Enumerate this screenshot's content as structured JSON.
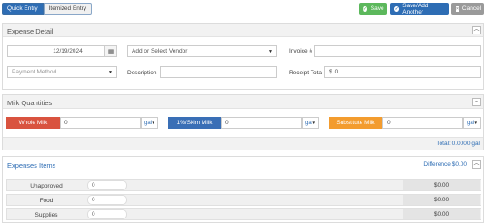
{
  "modes": {
    "quick": "Quick Entry",
    "itemized": "Itemized Entry"
  },
  "actions": {
    "save": "Save",
    "save_add": "Save/Add Another",
    "cancel": "Cancel"
  },
  "expense_detail": {
    "title": "Expense Detail",
    "date": "12/19/2024",
    "vendor_placeholder": "Add or Select Vendor",
    "invoice_label": "Invoice #",
    "invoice_value": "",
    "payment_placeholder": "Payment Method",
    "description_label": "Description",
    "description_value": "",
    "receipt_label": "Receipt Total",
    "receipt_currency": "$",
    "receipt_value": "0"
  },
  "milk": {
    "title": "Milk Quantities",
    "items": [
      {
        "label": "Whole Milk",
        "value": "0",
        "unit": "gal",
        "color": "#d9533f"
      },
      {
        "label": "1%/Skim Milk",
        "value": "0",
        "unit": "gal",
        "color": "#3a6fb6"
      },
      {
        "label": "Substitute Milk",
        "value": "0",
        "unit": "gal",
        "color": "#f39c2f"
      }
    ],
    "total": "Total: 0.0000 gal"
  },
  "expenses": {
    "title": "Expenses Items",
    "difference": "Difference $0.00",
    "rows": [
      {
        "label": "Unapproved",
        "value": "0",
        "amount": "$0.00"
      },
      {
        "label": "Food",
        "value": "0",
        "amount": "$0.00"
      },
      {
        "label": "Supplies",
        "value": "0",
        "amount": "$0.00"
      }
    ]
  }
}
